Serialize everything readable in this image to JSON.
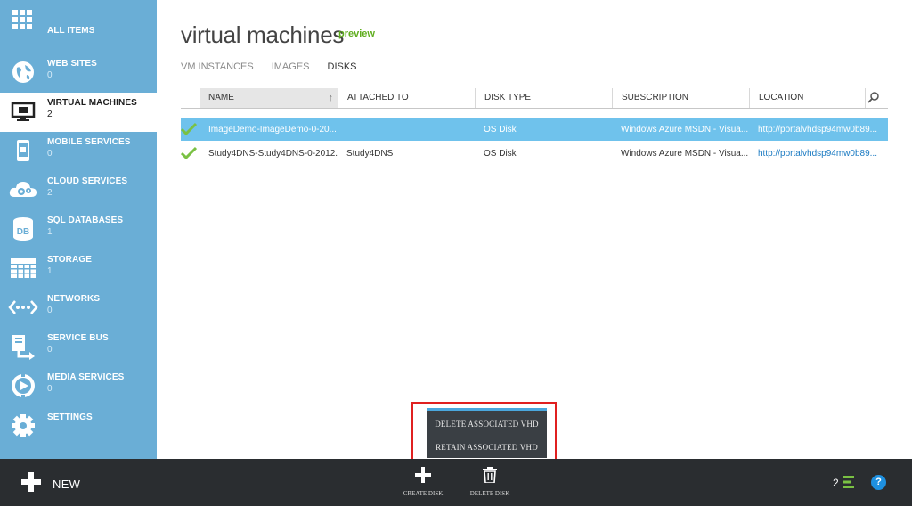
{
  "sidebar": {
    "items": [
      {
        "label": "ALL ITEMS",
        "count": "",
        "icon": "grid-icon"
      },
      {
        "label": "WEB SITES",
        "count": "0",
        "icon": "globe-icon"
      },
      {
        "label": "VIRTUAL MACHINES",
        "count": "2",
        "icon": "monitor-icon"
      },
      {
        "label": "MOBILE SERVICES",
        "count": "0",
        "icon": "mobile-icon"
      },
      {
        "label": "CLOUD SERVICES",
        "count": "2",
        "icon": "cloud-gear-icon"
      },
      {
        "label": "SQL DATABASES",
        "count": "1",
        "icon": "database-icon"
      },
      {
        "label": "STORAGE",
        "count": "1",
        "icon": "storage-table-icon"
      },
      {
        "label": "NETWORKS",
        "count": "0",
        "icon": "network-icon"
      },
      {
        "label": "SERVICE BUS",
        "count": "0",
        "icon": "service-bus-icon"
      },
      {
        "label": "MEDIA SERVICES",
        "count": "0",
        "icon": "media-icon"
      },
      {
        "label": "SETTINGS",
        "count": "",
        "icon": "settings-gear-icon"
      }
    ]
  },
  "header": {
    "title": "virtual machines",
    "badge": "preview"
  },
  "tabs": [
    {
      "label": "VM INSTANCES",
      "active": false
    },
    {
      "label": "IMAGES",
      "active": false
    },
    {
      "label": "DISKS",
      "active": true
    }
  ],
  "table": {
    "columns": [
      "NAME",
      "ATTACHED TO",
      "DISK TYPE",
      "SUBSCRIPTION",
      "LOCATION"
    ],
    "rows": [
      {
        "name": "ImageDemo-ImageDemo-0-20...",
        "attached_to": "",
        "disk_type": "OS Disk",
        "subscription": "Windows Azure MSDN - Visua...",
        "location": "http://portalvhdsp94mw0b89...",
        "selected": true
      },
      {
        "name": "Study4DNS-Study4DNS-0-2012...",
        "attached_to": "Study4DNS",
        "disk_type": "OS Disk",
        "subscription": "Windows Azure MSDN - Visua...",
        "location": "http://portalvhdsp94mw0b89...",
        "selected": false
      }
    ]
  },
  "context_menu": {
    "items": [
      "DELETE ASSOCIATED VHD",
      "RETAIN ASSOCIATED VHD"
    ]
  },
  "bottom_bar": {
    "new_label": "NEW",
    "commands": [
      {
        "label": "CREATE DISK",
        "icon": "plus-icon"
      },
      {
        "label": "DELETE DISK",
        "icon": "trash-icon"
      }
    ],
    "status_count": "2",
    "help_label": "?"
  },
  "colors": {
    "sidebar": "#6aaed6",
    "selected_row": "#6fc2ec",
    "bottom_bar": "#2a2d30",
    "accent_green": "#5fad1e",
    "highlight_red": "#e02020"
  }
}
